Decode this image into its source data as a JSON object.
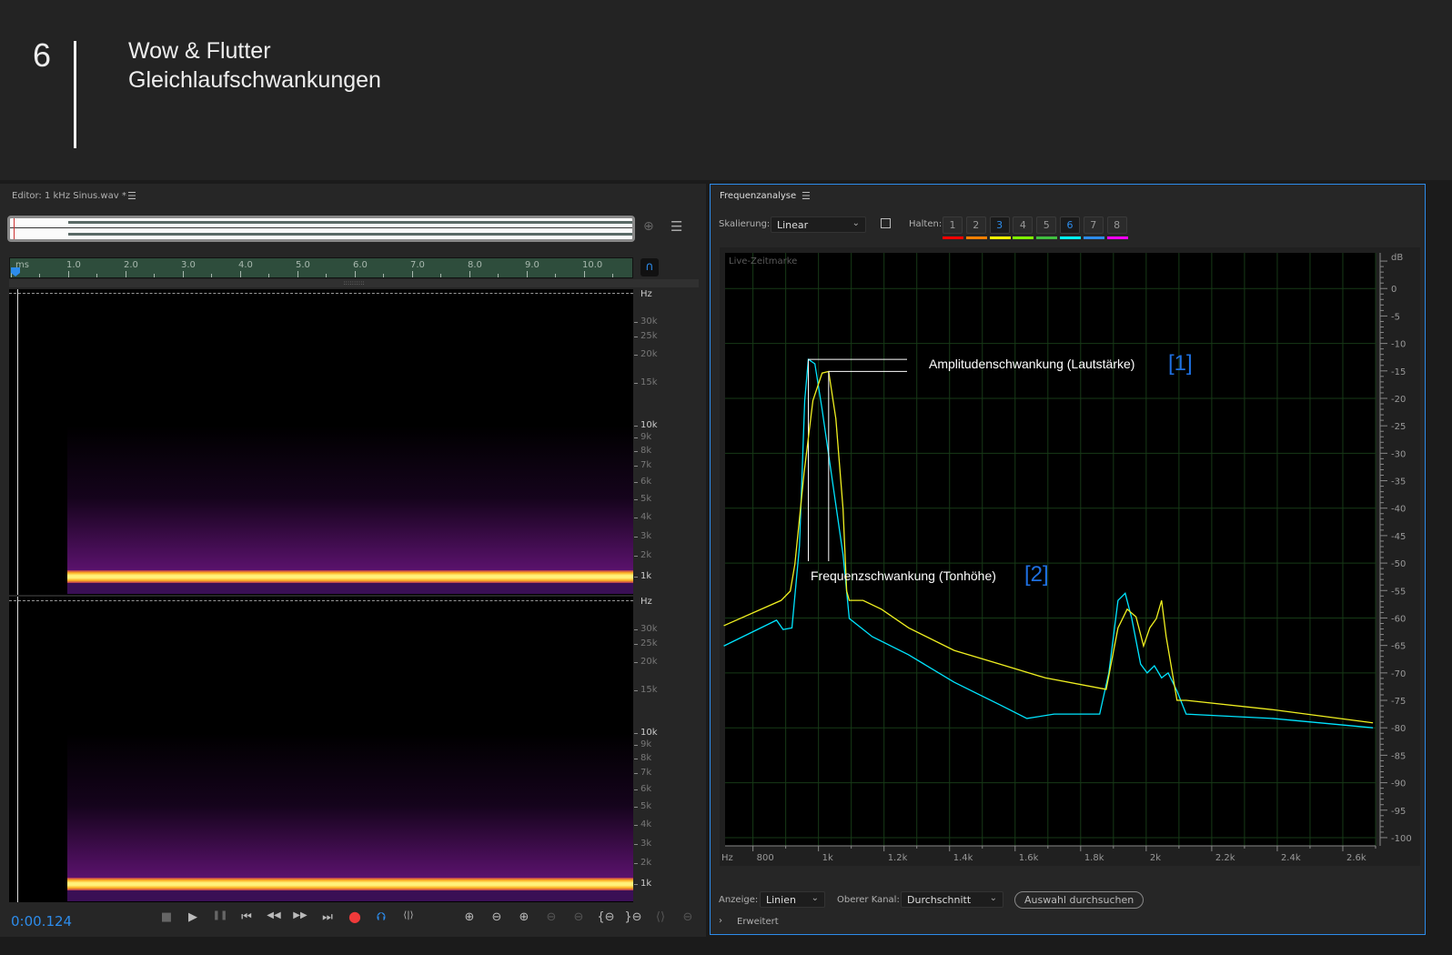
{
  "slide": {
    "number": "6",
    "title_line1": "Wow & Flutter",
    "title_line2": "Gleichlaufschwankungen"
  },
  "editor": {
    "title": "Editor: 1 kHz Sinus.wav *",
    "ruler_unit": "ms",
    "ruler_labels": [
      "1.0",
      "2.0",
      "3.0",
      "4.0",
      "5.0",
      "6.0",
      "7.0",
      "8.0",
      "9.0",
      "10.0"
    ],
    "freq_unit": "Hz",
    "freq_labels": [
      "30k",
      "25k",
      "20k",
      "15k",
      "10k",
      "9k",
      "8k",
      "7k",
      "6k",
      "5k",
      "4k",
      "3k",
      "2k",
      "1k"
    ],
    "time": "0:00.124",
    "transport": {
      "stop": "■",
      "play": "▶",
      "pause": "❚❚",
      "to_start": "⏮",
      "rewind": "◀◀",
      "forward": "▶▶",
      "to_end": "⏭",
      "record": "●",
      "loop": "⮉",
      "skip": "⟨|⟩"
    },
    "zoom_tools": [
      "zoom-in-amplitude",
      "zoom-out-amplitude",
      "zoom-in-time",
      "zoom-out-time",
      "zoom-out-full",
      "zoom-in-left",
      "zoom-in-right",
      "zoom-selection",
      "zoom-reset"
    ]
  },
  "freq": {
    "title": "Frequenzanalyse",
    "scale_label": "Skalierung:",
    "scale_value": "Linear",
    "hold_label": "Halten:",
    "holds": [
      {
        "label": "1",
        "color": "#ff0000",
        "active": false
      },
      {
        "label": "2",
        "color": "#ff8000",
        "active": false
      },
      {
        "label": "3",
        "color": "#ffff00",
        "active": true
      },
      {
        "label": "4",
        "color": "#80ff00",
        "active": false
      },
      {
        "label": "5",
        "color": "#40c040",
        "active": false
      },
      {
        "label": "6",
        "color": "#00ffff",
        "active": true
      },
      {
        "label": "7",
        "color": "#2d8ceb",
        "active": false
      },
      {
        "label": "8",
        "color": "#ff00ff",
        "active": false
      }
    ],
    "live_label": "Live-Zeitmarke",
    "display_label": "Anzeige:",
    "display_value": "Linien",
    "channel_label": "Oberer Kanal:",
    "channel_value": "Durchschnitt",
    "scan_button": "Auswahl durchsuchen",
    "advanced": "Erweitert",
    "annotation_amp": "Amplitudenschwankung (Lautstärke)",
    "annotation_amp_ref": "[1]",
    "annotation_freq": "Frequenzschwankung (Tonhöhe)",
    "annotation_freq_ref": "[2]"
  },
  "chart_data": {
    "type": "line",
    "xlabel": "Hz",
    "ylabel": "dB",
    "xlim": [
      715,
      2700
    ],
    "ylim": [
      -101.5,
      6.5
    ],
    "x_ticks": [
      800,
      1000,
      1200,
      1400,
      1600,
      1800,
      2000,
      2200,
      2400,
      2600
    ],
    "x_tick_labels": [
      "800",
      "1k",
      "1.2k",
      "1.4k",
      "1.6k",
      "1.8k",
      "2k",
      "2.2k",
      "2.4k",
      "2.6k"
    ],
    "y_ticks": [
      0,
      -5,
      -10,
      -15,
      -20,
      -25,
      -30,
      -35,
      -40,
      -45,
      -50,
      -55,
      -60,
      -65,
      -70,
      -75,
      -80,
      -85,
      -90,
      -95,
      -100
    ],
    "grid": true,
    "series": [
      {
        "color": "#00e5ff",
        "points": [
          [
            711,
            -65.1
          ],
          [
            872,
            -60.4
          ],
          [
            892,
            -62.1
          ],
          [
            919,
            -61.8
          ],
          [
            942,
            -46.9
          ],
          [
            958,
            -20.4
          ],
          [
            969,
            -12.9
          ],
          [
            989,
            -13.7
          ],
          [
            1011,
            -22
          ],
          [
            1039,
            -33.6
          ],
          [
            1075,
            -48.5
          ],
          [
            1094,
            -60.1
          ],
          [
            1164,
            -63.4
          ],
          [
            1275,
            -66.7
          ],
          [
            1414,
            -71.7
          ],
          [
            1553,
            -75.8
          ],
          [
            1636,
            -78.3
          ],
          [
            1719,
            -77.5
          ],
          [
            1858,
            -77.5
          ],
          [
            1886,
            -70
          ],
          [
            1914,
            -56.8
          ],
          [
            1936,
            -55.5
          ],
          [
            1956,
            -60.1
          ],
          [
            1983,
            -68.4
          ],
          [
            2003,
            -70
          ],
          [
            2025,
            -68.7
          ],
          [
            2047,
            -70.9
          ],
          [
            2067,
            -70
          ],
          [
            2094,
            -73.3
          ],
          [
            2122,
            -77.5
          ],
          [
            2386,
            -78.3
          ],
          [
            2692,
            -80
          ]
        ]
      },
      {
        "color": "#f0f020",
        "points": [
          [
            711,
            -61.4
          ],
          [
            886,
            -56.8
          ],
          [
            914,
            -55.1
          ],
          [
            928,
            -50.2
          ],
          [
            956,
            -33.6
          ],
          [
            983,
            -20.4
          ],
          [
            1011,
            -15.4
          ],
          [
            1031,
            -15.1
          ],
          [
            1053,
            -23.7
          ],
          [
            1075,
            -40.2
          ],
          [
            1086,
            -55.1
          ],
          [
            1094,
            -56.8
          ],
          [
            1136,
            -56.8
          ],
          [
            1192,
            -58.4
          ],
          [
            1275,
            -61.8
          ],
          [
            1414,
            -65.9
          ],
          [
            1553,
            -68.4
          ],
          [
            1692,
            -70.9
          ],
          [
            1878,
            -73
          ],
          [
            1914,
            -61.8
          ],
          [
            1942,
            -58.4
          ],
          [
            1969,
            -59.8
          ],
          [
            1992,
            -65.1
          ],
          [
            2011,
            -61.8
          ],
          [
            2031,
            -60.1
          ],
          [
            2047,
            -56.8
          ],
          [
            2061,
            -63.4
          ],
          [
            2094,
            -75
          ],
          [
            2122,
            -75
          ],
          [
            2386,
            -76.7
          ],
          [
            2692,
            -79.1
          ]
        ]
      }
    ]
  }
}
